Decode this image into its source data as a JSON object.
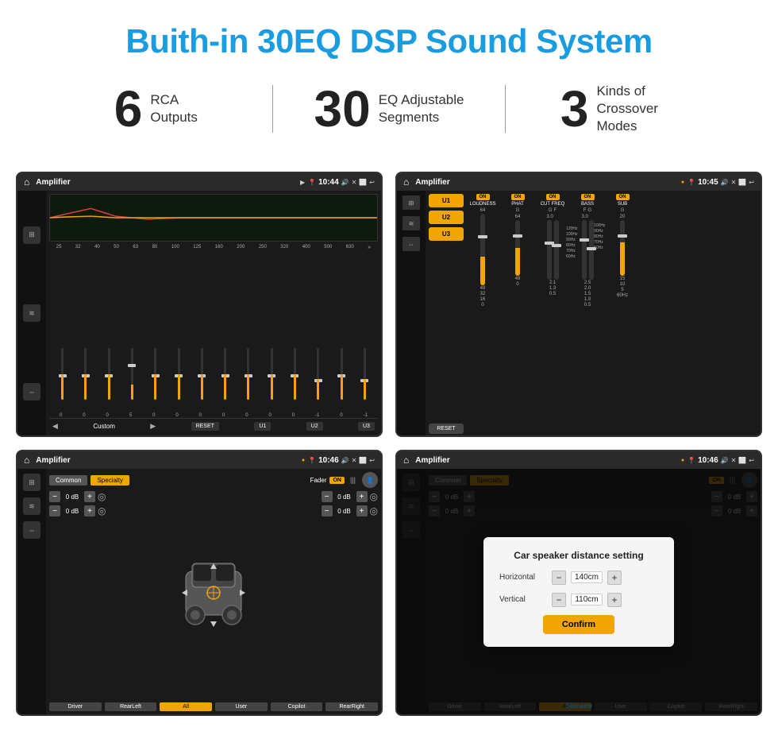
{
  "page": {
    "title": "Buith-in 30EQ DSP Sound System"
  },
  "stats": [
    {
      "number": "6",
      "label": "RCA\nOutputs"
    },
    {
      "number": "30",
      "label": "EQ Adjustable\nSegments"
    },
    {
      "number": "3",
      "label": "Kinds of\nCrossover Modes"
    }
  ],
  "screens": {
    "eq": {
      "title": "Amplifier",
      "time": "10:44",
      "freq_labels": [
        "25",
        "32",
        "40",
        "50",
        "63",
        "80",
        "100",
        "125",
        "160",
        "200",
        "250",
        "320",
        "400",
        "500",
        "630"
      ],
      "slider_values": [
        "0",
        "0",
        "0",
        "5",
        "0",
        "0",
        "0",
        "0",
        "0",
        "0",
        "0",
        "-1",
        "0",
        "-1"
      ],
      "bottom_label": "Custom",
      "buttons": [
        "RESET",
        "U1",
        "U2",
        "U3"
      ]
    },
    "amp": {
      "title": "Amplifier",
      "time": "10:45",
      "channels": [
        {
          "on": true,
          "label": "LOUDNESS"
        },
        {
          "on": true,
          "label": "PHAT"
        },
        {
          "on": true,
          "label": "CUT FREQ"
        },
        {
          "on": true,
          "label": "BASS"
        },
        {
          "on": true,
          "label": "SUB"
        }
      ],
      "u_buttons": [
        "U1",
        "U2",
        "U3"
      ],
      "reset_label": "RESET"
    },
    "fader": {
      "title": "Amplifier",
      "time": "10:46",
      "tabs": [
        "Common",
        "Specialty"
      ],
      "fader_label": "Fader",
      "on_label": "ON",
      "channels": [
        {
          "label": "0 dB"
        },
        {
          "label": "0 dB"
        },
        {
          "label": "0 dB"
        },
        {
          "label": "0 dB"
        }
      ],
      "bottom_buttons": [
        "Driver",
        "RearLeft",
        "All",
        "User",
        "Copilot",
        "RearRight"
      ]
    },
    "dialog": {
      "title": "Amplifier",
      "time": "10:46",
      "dialog_title": "Car speaker distance setting",
      "horizontal_label": "Horizontal",
      "horizontal_value": "140cm",
      "vertical_label": "Vertical",
      "vertical_value": "110cm",
      "confirm_label": "Confirm",
      "tabs": [
        "Common",
        "Specialty"
      ],
      "on_label": "ON"
    }
  }
}
